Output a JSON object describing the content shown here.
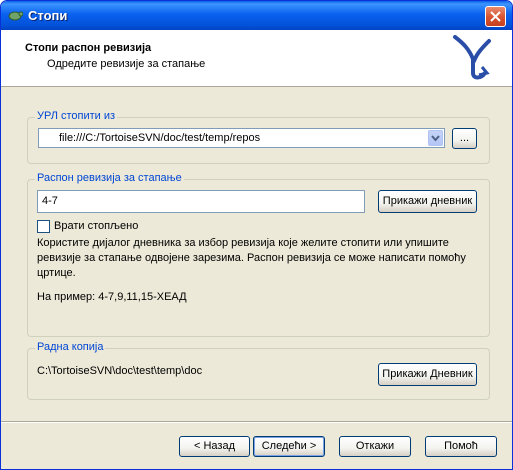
{
  "window": {
    "title": "Стопи",
    "close_label": ""
  },
  "header": {
    "title": "Стопи распон ревизија",
    "subtitle": "Одредите ревизије за стапање"
  },
  "url_group": {
    "legend": "УРЛ стопити из",
    "url_value": "file:///C:/TortoiseSVN/doc/test/temp/repos",
    "browse_label": "..."
  },
  "range_group": {
    "legend": "Распон ревизија за стапање",
    "range_value": "4-7",
    "show_log_label": "Прикажи дневник",
    "reverse_merge_label": "Врати стопљено",
    "reverse_merge_checked": false,
    "help_line1": "Користите дијалог дневника за избор ревизија које желите стопити или упишите",
    "help_line2": "ревизије за стапање одвојене зарезима. Распон ревизија се може написати помоћу",
    "help_line3": "цртице.",
    "example": "На пример: 4-7,9,11,15-ХЕАД"
  },
  "wc_group": {
    "legend": "Радна копија",
    "path": "C:\\TortoiseSVN\\doc\\test\\temp\\doc",
    "show_log_label": "Прикажи Дневник"
  },
  "footer": {
    "back_label": "< Назад",
    "next_label": "Следећи >",
    "cancel_label": "Откажи",
    "help_label": "Помоћ"
  },
  "colors": {
    "titlebar": "#0a62f0",
    "legend": "#0046d5",
    "logo": "#2a4ea8"
  }
}
